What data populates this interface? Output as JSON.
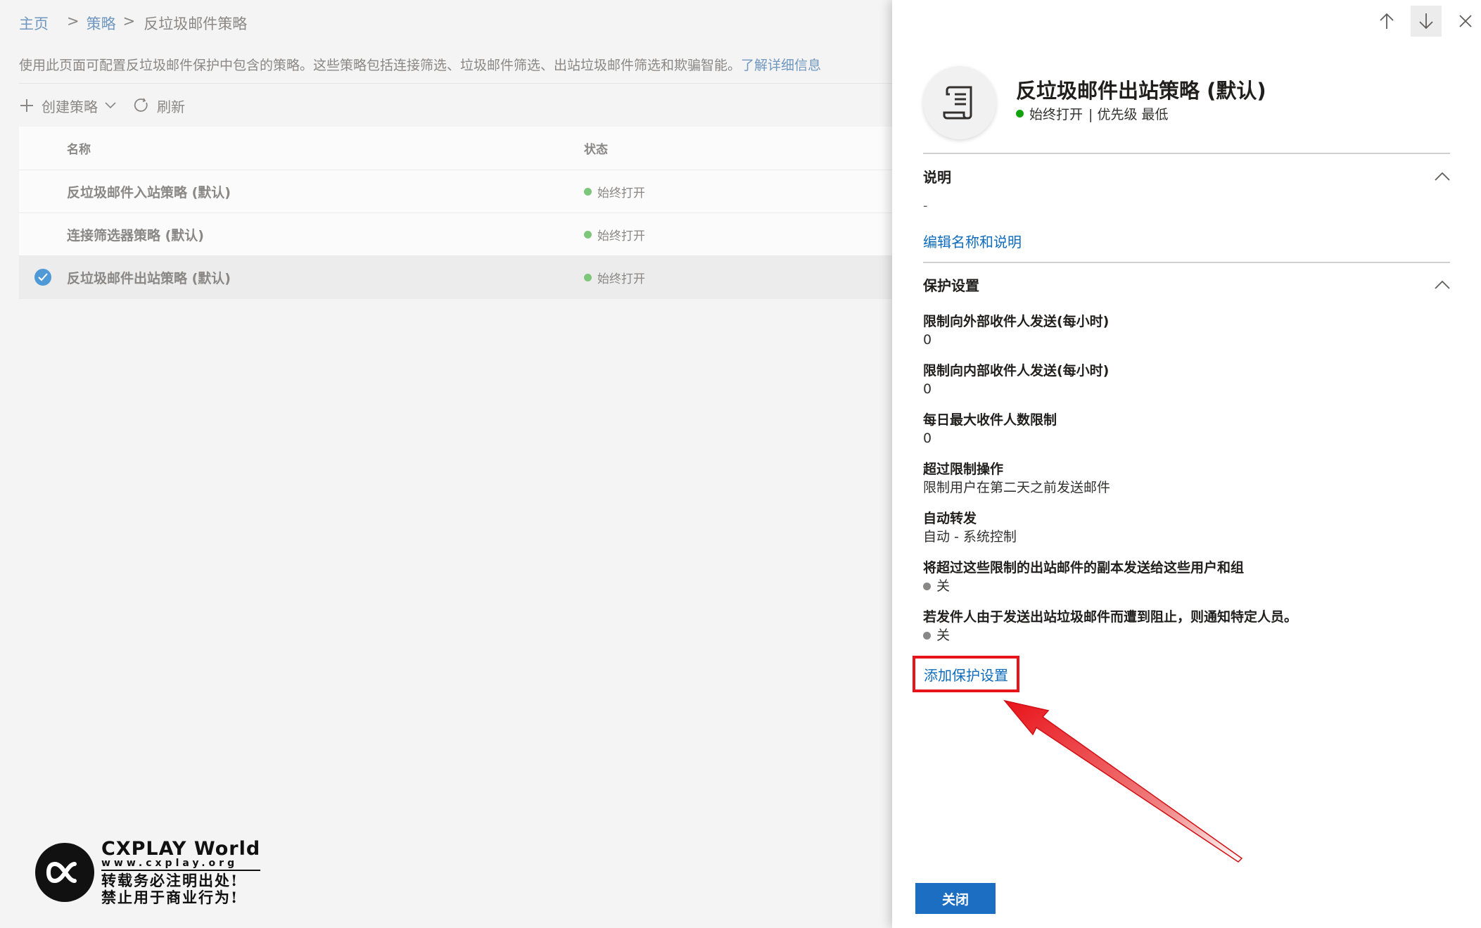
{
  "breadcrumb": {
    "home": "主页",
    "policies": "策略",
    "current": "反垃圾邮件策略",
    "sep": ">"
  },
  "intro": {
    "text": "使用此页面可配置反垃圾邮件保护中包含的策略。这些策略包括连接筛选、垃圾邮件筛选、出站垃圾邮件筛选和欺骗智能。",
    "link": "了解详细信息"
  },
  "toolbar": {
    "create_label": "创建策略",
    "refresh_label": "刷新"
  },
  "table": {
    "columns": {
      "name": "名称",
      "status": "状态"
    },
    "rows": [
      {
        "name": "反垃圾邮件入站策略 (默认)",
        "status": "始终打开",
        "selected": false
      },
      {
        "name": "连接筛选器策略 (默认)",
        "status": "始终打开",
        "selected": false
      },
      {
        "name": "反垃圾邮件出站策略 (默认)",
        "status": "始终打开",
        "selected": true
      }
    ]
  },
  "watermark": {
    "brand": "CXPLAY World",
    "url": "www.cxplay.org",
    "line1": "转载务必注明出处!",
    "line2": "禁止用于商业行为!"
  },
  "panel": {
    "icon": "policy-document-icon",
    "title": "反垃圾邮件出站策略 (默认)",
    "status": "始终打开",
    "priority": "| 优先级 最低",
    "description_section": {
      "heading": "说明",
      "value": "-",
      "edit_link": "编辑名称和说明"
    },
    "protection_section": {
      "heading": "保护设置",
      "settings": [
        {
          "label": "限制向外部收件人发送(每小时)",
          "value": "0"
        },
        {
          "label": "限制向内部收件人发送(每小时)",
          "value": "0"
        },
        {
          "label": "每日最大收件人数限制",
          "value": "0"
        },
        {
          "label": "超过限制操作",
          "value": "限制用户在第二天之前发送邮件"
        },
        {
          "label": "自动转发",
          "value": "自动 - 系统控制"
        },
        {
          "label": "将超过这些限制的出站邮件的副本发送给这些用户和组",
          "value": "关"
        },
        {
          "label": "若发件人由于发送出站垃圾邮件而遭到阻止，则通知特定人员。",
          "value": "关"
        }
      ],
      "add_link": "添加保护设置"
    },
    "close_label": "关闭"
  },
  "colors": {
    "accent": "#0f6cbd",
    "primary_button": "#1b6ec2",
    "highlight": "#e8141b",
    "status_on": "#13a10e"
  }
}
